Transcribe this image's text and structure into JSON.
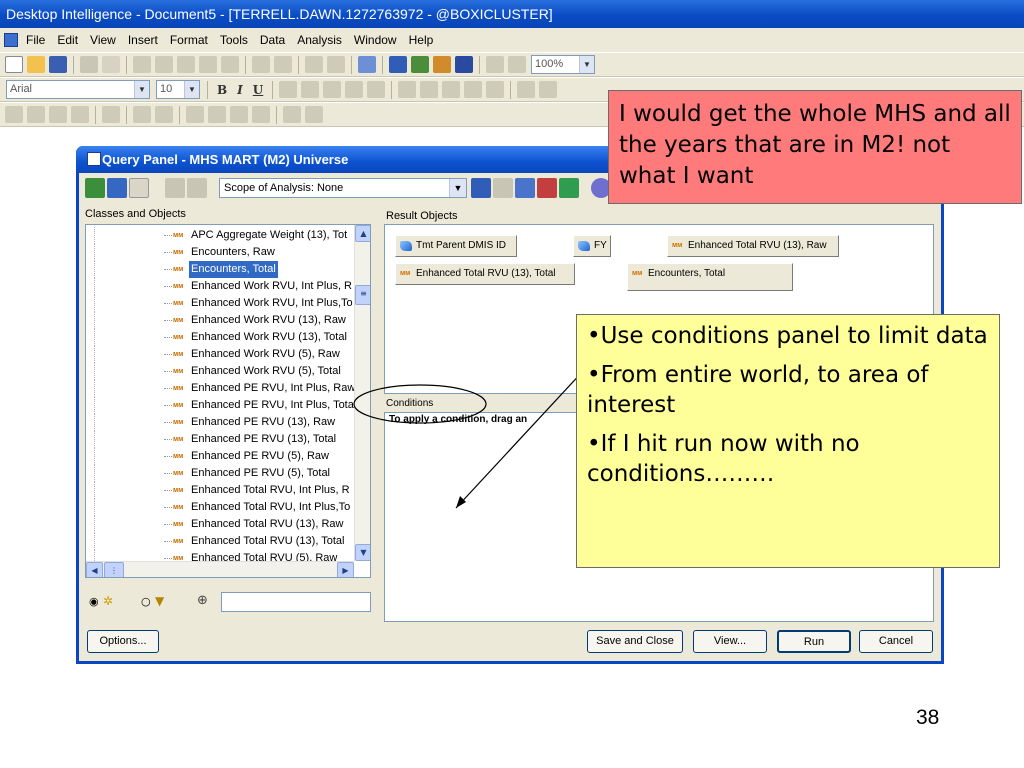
{
  "window": {
    "title": "Desktop Intelligence - Document5 - [TERRELL.DAWN.1272763972 - @BOXICLUSTER]"
  },
  "menubar": {
    "items": [
      "File",
      "Edit",
      "View",
      "Insert",
      "Format",
      "Tools",
      "Data",
      "Analysis",
      "Window",
      "Help"
    ]
  },
  "toolbar": {
    "zoom_value": "100%",
    "font_name": "Arial",
    "font_size": "10",
    "bold_label": "B",
    "italic_label": "I",
    "underline_label": "U"
  },
  "query_panel": {
    "title": "Query Panel - MHS MART (M2) Universe",
    "scope_of_analysis": "Scope of Analysis: None",
    "classes_label": "Classes and Objects",
    "result_label": "Result Objects",
    "conditions_label": "Conditions",
    "conditions_hint": "To apply a condition, drag an",
    "classes_objects": [
      "APC Aggregate Weight (13), Tot",
      "Encounters, Raw",
      "Encounters, Total",
      "Enhanced Work RVU, Int Plus, R",
      "Enhanced Work RVU, Int Plus,To",
      "Enhanced Work RVU (13), Raw",
      "Enhanced Work RVU (13), Total",
      "Enhanced Work RVU (5), Raw",
      "Enhanced Work RVU (5), Total",
      "Enhanced PE RVU, Int Plus, Raw",
      "Enhanced PE RVU, Int Plus, Tota",
      "Enhanced PE RVU (13), Raw",
      "Enhanced PE RVU (13), Total",
      "Enhanced PE RVU (5), Raw",
      "Enhanced PE RVU (5), Total",
      "Enhanced Total RVU, Int Plus, R",
      "Enhanced Total RVU, Int Plus,To",
      "Enhanced Total RVU (13), Raw",
      "Enhanced Total RVU (13), Total",
      "Enhanced Total RVU (5), Raw"
    ],
    "selected_object": "Encounters, Total",
    "result_objects": [
      {
        "label": "Tmt Parent DMIS ID",
        "kind": "dimension"
      },
      {
        "label": "FY",
        "kind": "dimension"
      },
      {
        "label": "Enhanced Total RVU (13), Raw",
        "kind": "measure"
      },
      {
        "label": "Enhanced Total RVU (13), Total",
        "kind": "measure"
      },
      {
        "label": "Encounters, Total",
        "kind": "measure"
      }
    ],
    "buttons": {
      "options": "Options...",
      "save_and_close": "Save and Close",
      "view": "View...",
      "run": "Run",
      "cancel": "Cancel"
    }
  },
  "callouts": {
    "red": "I would get the whole MHS and all the years that are in M2!  not what I want",
    "yellow": [
      "•Use conditions panel to limit data",
      "•From entire world, to area of interest",
      "•If I hit run now with no conditions………"
    ]
  },
  "slide": {
    "page_number": "38"
  },
  "colors": {
    "titlebar": "#0a4cc4",
    "selection": "#316ac5",
    "red_callout": "#ff7b7b",
    "yellow_callout": "#ffff99",
    "dialog_face": "#ece9d8"
  },
  "icons": [
    "document-icon",
    "query-panel-icon",
    "dimension-icon",
    "measure-icon",
    "binoculars-icon",
    "filter-icon",
    "sort-icon"
  ]
}
